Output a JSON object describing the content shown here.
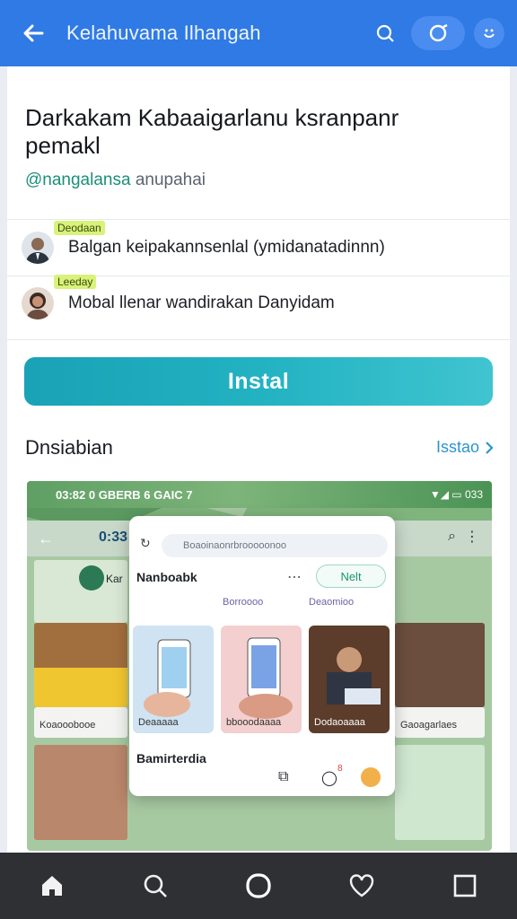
{
  "header": {
    "title": "Kelahuvama Ilhangah",
    "icons": [
      "arrow-left-icon",
      "search-icon",
      "camera-icon",
      "smile-icon"
    ]
  },
  "post": {
    "title": "Darkakam Kabaaigarlanu ksranpanr pemakl",
    "handle": "@nangalansa",
    "handle_suffix": " anupahai"
  },
  "people": [
    {
      "tag": "Deodaan",
      "text": "Balgan keipakannsenlal (ymidanatadinnn)",
      "avatar_color": "#5c6b7a"
    },
    {
      "tag": "Leeday",
      "text": "Mobal llenar wandirakan Danyidam",
      "avatar_color": "#c48a6a"
    }
  ],
  "install": {
    "label": "Instal",
    "gradient": [
      "#1aa2b6",
      "#40c4d0"
    ]
  },
  "section": {
    "title": "Dnsiabian",
    "link": "Isstao"
  },
  "screenshot": {
    "status_left": "03:82 0 GBERB 6 GAIC 7",
    "status_right": "033",
    "app_bar": "0:33",
    "tile_caption_a": "Koaooobooe",
    "tile_caption_b": "Gaoagarlaes",
    "tile_title": "Kar",
    "search_placeholder": "Boaoinaonrbrooooonoo",
    "popup_name": "Nanboabk",
    "next_label": "Nelt",
    "mini_left": "Borroooo",
    "mini_right": "Deaomioo",
    "thumb_captions": [
      "Deaaaaa",
      "bbooodaaaa",
      "Dodaoaaaa"
    ],
    "popup_footer": "Bamirterdia",
    "badge": "8"
  },
  "navbar": {
    "icons": [
      "home-icon",
      "search-icon",
      "circle-icon",
      "heart-icon",
      "square-icon"
    ]
  }
}
